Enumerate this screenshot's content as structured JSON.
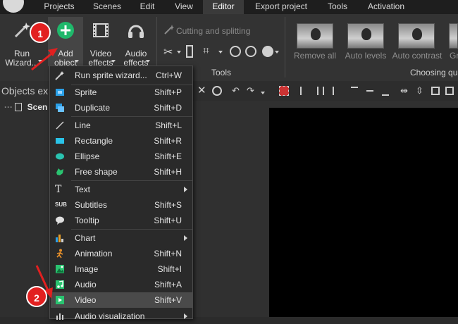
{
  "menu": {
    "tabs": [
      {
        "label": "Projects"
      },
      {
        "label": "Scenes"
      },
      {
        "label": "Edit"
      },
      {
        "label": "View"
      },
      {
        "label": "Editor"
      },
      {
        "label": "Export project"
      },
      {
        "label": "Tools"
      },
      {
        "label": "Activation"
      }
    ],
    "active_tab": "Editor"
  },
  "ribbon": {
    "run_wizard": {
      "line1": "Run",
      "line2": "Wizard..."
    },
    "add_object": {
      "line1": "Add",
      "line2": "object"
    },
    "video_effects": {
      "line1": "Video",
      "line2": "effects"
    },
    "audio_effects": {
      "line1": "Audio",
      "line2": "effects"
    },
    "cutting_label": "Cutting and splitting",
    "tools_caption": "Tools",
    "choosing_caption": "Choosing qu",
    "effect_thumbs": [
      {
        "label": "Remove all"
      },
      {
        "label": "Auto levels"
      },
      {
        "label": "Auto contrast"
      },
      {
        "label": "Gr"
      }
    ]
  },
  "objects_panel": {
    "title": "Objects ex",
    "scene_label": "Scen"
  },
  "dropdown": {
    "items": [
      {
        "label": "Run sprite wizard...",
        "shortcut": "Ctrl+W",
        "icon": "wand-icon"
      },
      {
        "label": "Sprite",
        "shortcut": "Shift+P",
        "icon": "sprite-icon"
      },
      {
        "label": "Duplicate",
        "shortcut": "Shift+D",
        "icon": "duplicate-icon"
      },
      {
        "label": "Line",
        "shortcut": "Shift+L",
        "icon": "line-icon"
      },
      {
        "label": "Rectangle",
        "shortcut": "Shift+R",
        "icon": "rectangle-icon"
      },
      {
        "label": "Ellipse",
        "shortcut": "Shift+E",
        "icon": "ellipse-icon"
      },
      {
        "label": "Free shape",
        "shortcut": "Shift+H",
        "icon": "free-shape-icon"
      },
      {
        "label": "Text",
        "shortcut": "",
        "icon": "text-icon"
      },
      {
        "label": "Subtitles",
        "shortcut": "Shift+S",
        "icon": "subtitles-icon"
      },
      {
        "label": "Tooltip",
        "shortcut": "Shift+U",
        "icon": "tooltip-icon"
      },
      {
        "label": "Chart",
        "shortcut": "",
        "icon": "chart-icon"
      },
      {
        "label": "Animation",
        "shortcut": "Shift+N",
        "icon": "animation-icon"
      },
      {
        "label": "Image",
        "shortcut": "Shift+I",
        "icon": "image-icon"
      },
      {
        "label": "Audio",
        "shortcut": "Shift+A",
        "icon": "audio-icon"
      },
      {
        "label": "Video",
        "shortcut": "Shift+V",
        "icon": "video-icon"
      },
      {
        "label": "Audio visualization",
        "shortcut": "",
        "icon": "audio-visualization-icon"
      }
    ],
    "highlighted": "Video"
  },
  "annotations": {
    "step1": "1",
    "step2": "2",
    "color": "#e22020"
  }
}
